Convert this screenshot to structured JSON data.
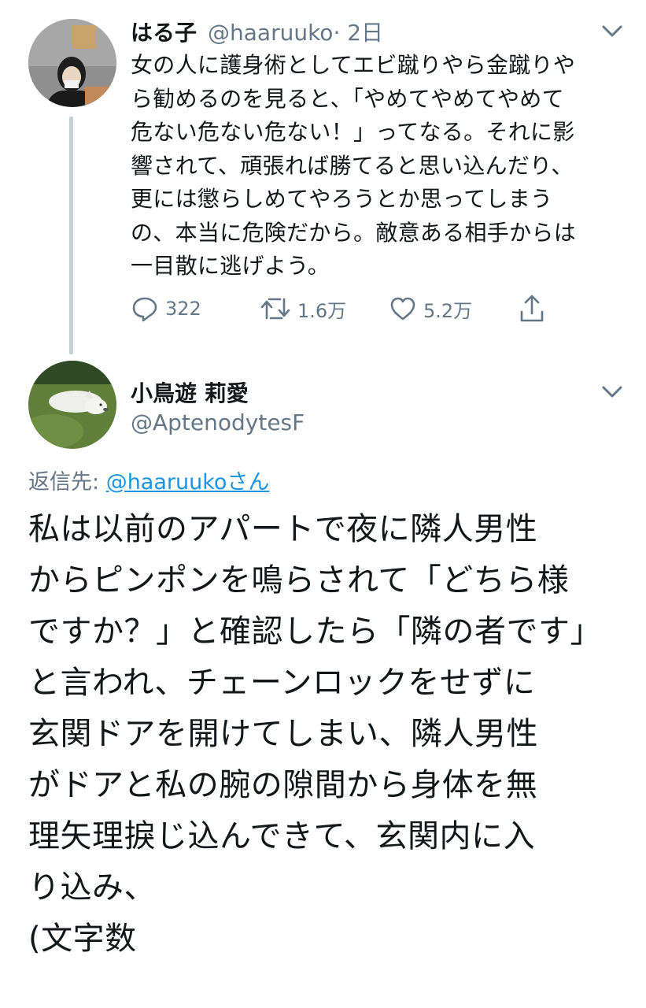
{
  "tweet1": {
    "display_name": "はる子",
    "handle": "@haaruuko",
    "time": "· 2日",
    "text": "女の人に護身術としてエビ蹴りやら金蹴りや\nら勧めるのを見ると、「やめてやめてやめて\n危ない危ない危ない！」ってなる。それに影\n響されて、頑張れば勝てると思い込んだり、\n更には懲らしめてやろうとか思ってしまう\nの、本当に危険だから。敵意ある相手からは\n一目散に逃げよう。",
    "actions": {
      "replies": "322",
      "retweets": "1.6万",
      "likes": "5.2万"
    },
    "icons": {
      "reply": "reply-icon",
      "retweet": "retweet-icon",
      "like": "heart-icon",
      "share": "share-icon",
      "menu": "chevron-down-icon"
    }
  },
  "tweet2": {
    "display_name": "小鳥遊 莉愛",
    "handle": "@AptenodytesF",
    "reply_prefix": "返信先: ",
    "reply_to": "@haaruukoさん",
    "text": "私は以前のアパートで夜に隣人男性\nからピンポンを鳴らされて「どちら様\nですか？」と確認したら「隣の者です」\nと言われ、チェーンロックをせずに\n玄関ドアを開けてしまい、隣人男性\nがドアと私の腕の隙間から身体を無\n理矢理捩じ込んできて、玄関内に入\nり込み、\n(文字数"
  },
  "colors": {
    "text": "#14171a",
    "secondary": "#657786",
    "link": "#1b95e0",
    "thread_line": "#c4cfd6"
  }
}
